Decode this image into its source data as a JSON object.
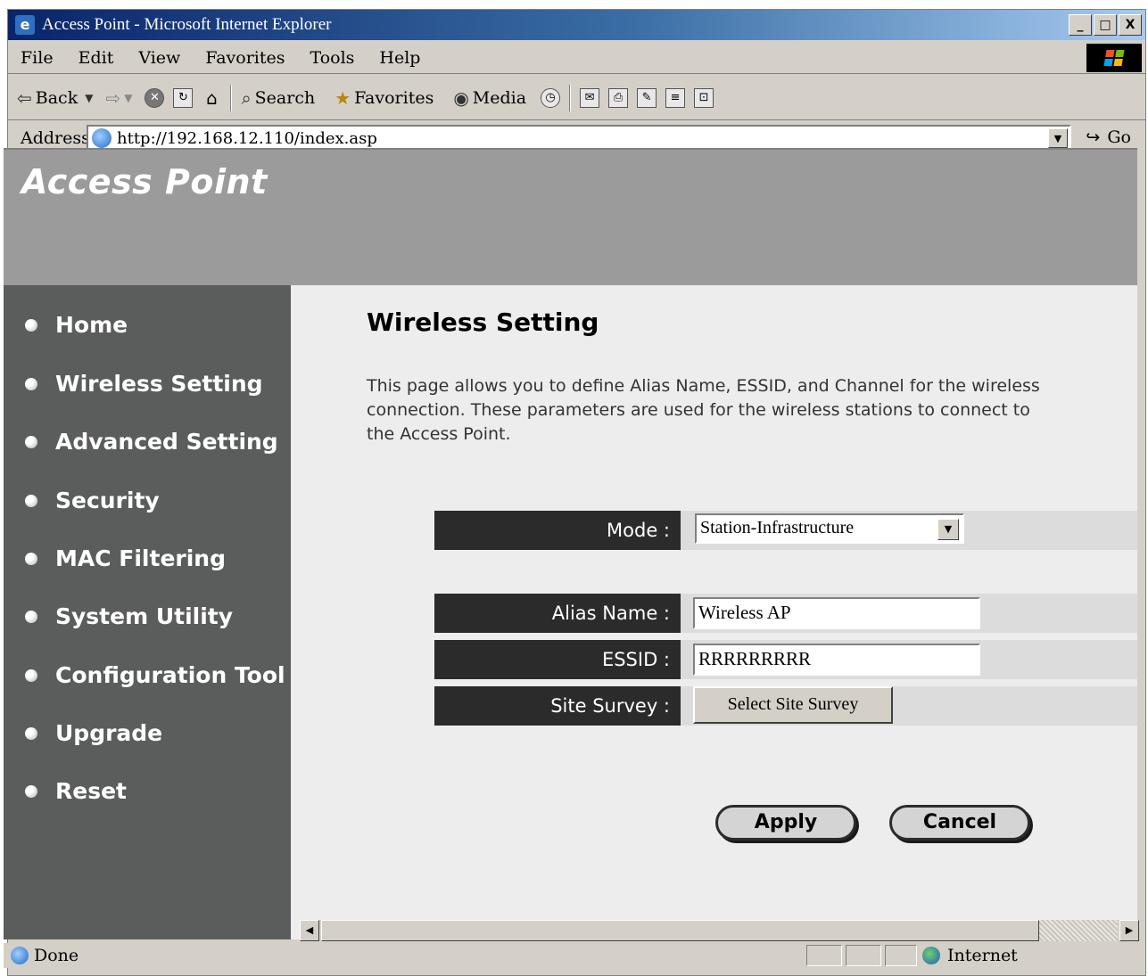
{
  "window": {
    "title": "Access Point - Microsoft Internet Explorer",
    "controls": {
      "minimize": "_",
      "maximize": "□",
      "close": "X"
    }
  },
  "menu": [
    "File",
    "Edit",
    "View",
    "Favorites",
    "Tools",
    "Help"
  ],
  "toolbar": {
    "back_label": "Back",
    "search_label": "Search",
    "favorites_label": "Favorites",
    "media_label": "Media"
  },
  "address_bar": {
    "label": "Address",
    "url": "http://192.168.12.110/index.asp",
    "go_label": "Go"
  },
  "page": {
    "banner_title": "Access Point",
    "nav": [
      "Home",
      "Wireless Setting",
      "Advanced Setting",
      "Security",
      "MAC Filtering",
      "System Utility",
      "Configuration Tool",
      "Upgrade",
      "Reset"
    ],
    "heading": "Wireless Setting",
    "description": "This page allows you to define Alias Name, ESSID, and Channel for the wireless connection. These parameters are used for the wireless stations to connect to the Access Point.",
    "form": {
      "mode_label": "Mode :",
      "mode_value": "Station-Infrastructure",
      "alias_label": "Alias Name :",
      "alias_value": "Wireless AP",
      "essid_label": "ESSID :",
      "essid_value": "RRRRRRRRR",
      "site_survey_label": "Site Survey :",
      "site_survey_button": "Select Site Survey"
    },
    "apply_label": "Apply",
    "cancel_label": "Cancel"
  },
  "status": {
    "text": "Done",
    "zone": "Internet"
  },
  "colors": {
    "banner": "#9b9b9b",
    "sidebar": "#5a5d5b",
    "label_cell": "#2b2b2b",
    "content_bg": "#ededed",
    "titlebar": "#0a246a"
  }
}
